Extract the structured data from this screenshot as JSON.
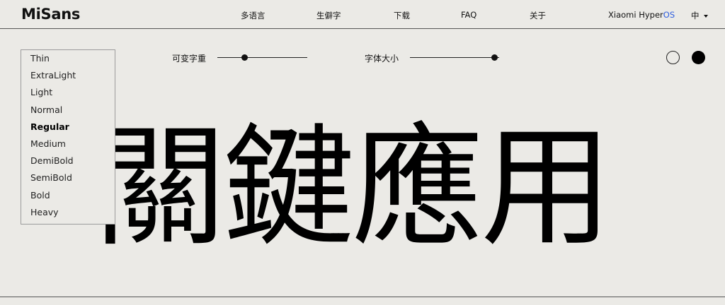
{
  "header": {
    "logo": "MiSans",
    "nav": [
      "多语言",
      "生僻字",
      "下载",
      "FAQ",
      "关于"
    ],
    "brand_prefix": "Xiaomi Hyper",
    "brand_suffix": "OS",
    "language": "中"
  },
  "weights": {
    "items": [
      "Thin",
      "ExtraLight",
      "Light",
      "Normal",
      "Regular",
      "Medium",
      "DemiBold",
      "SemiBold",
      "Bold",
      "Heavy"
    ],
    "selected": "Regular"
  },
  "controls": {
    "variable_weight_label": "可变字重",
    "font_size_label": "字体大小",
    "variable_weight_value": 0.3,
    "font_size_value": 0.95
  },
  "preview": {
    "text": "關鍵應用"
  },
  "colors": {
    "background": "#ebeae6",
    "text": "#000000",
    "accent": "#2f5fe0"
  },
  "icons": {
    "light_theme": "circle-outline-icon",
    "dark_theme": "circle-filled-icon",
    "language_caret": "caret-down-icon"
  }
}
